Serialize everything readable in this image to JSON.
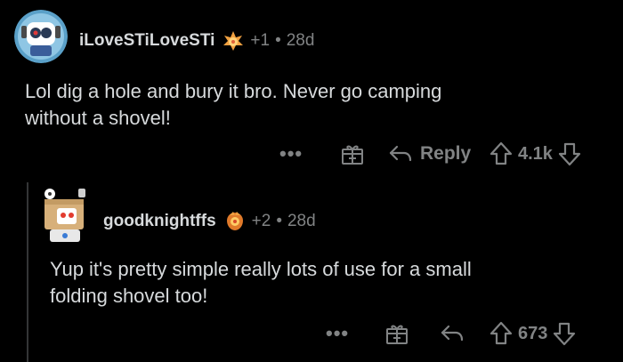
{
  "comments": [
    {
      "username": "iLoveSTiLoveSTi",
      "award_count": "+1",
      "separator": "•",
      "age": "28d",
      "body_line1": "Lol dig a hole and bury it bro. Never go camping",
      "body_line2": "without a shovel!",
      "more_label": "•••",
      "reply_label": "Reply",
      "score": "4.1k"
    },
    {
      "username": "goodknightffs",
      "award_count": "+2",
      "separator": "•",
      "age": "28d",
      "body_line1": "Yup it's pretty simple really lots of use for a small",
      "body_line2": "folding shovel too!",
      "more_label": "•••",
      "reply_label": "",
      "score": "673"
    }
  ],
  "icons": {
    "avatar_1": "robot-avatar",
    "avatar_2": "box-head-avatar",
    "award": "award-icon",
    "gift": "gift-icon",
    "reply": "reply-arrow-icon",
    "upvote": "upvote-arrow-icon",
    "downvote": "downvote-arrow-icon"
  },
  "colors": {
    "background": "#000000",
    "text": "#d7dadc",
    "muted": "#818384",
    "thread_line": "#343536"
  }
}
